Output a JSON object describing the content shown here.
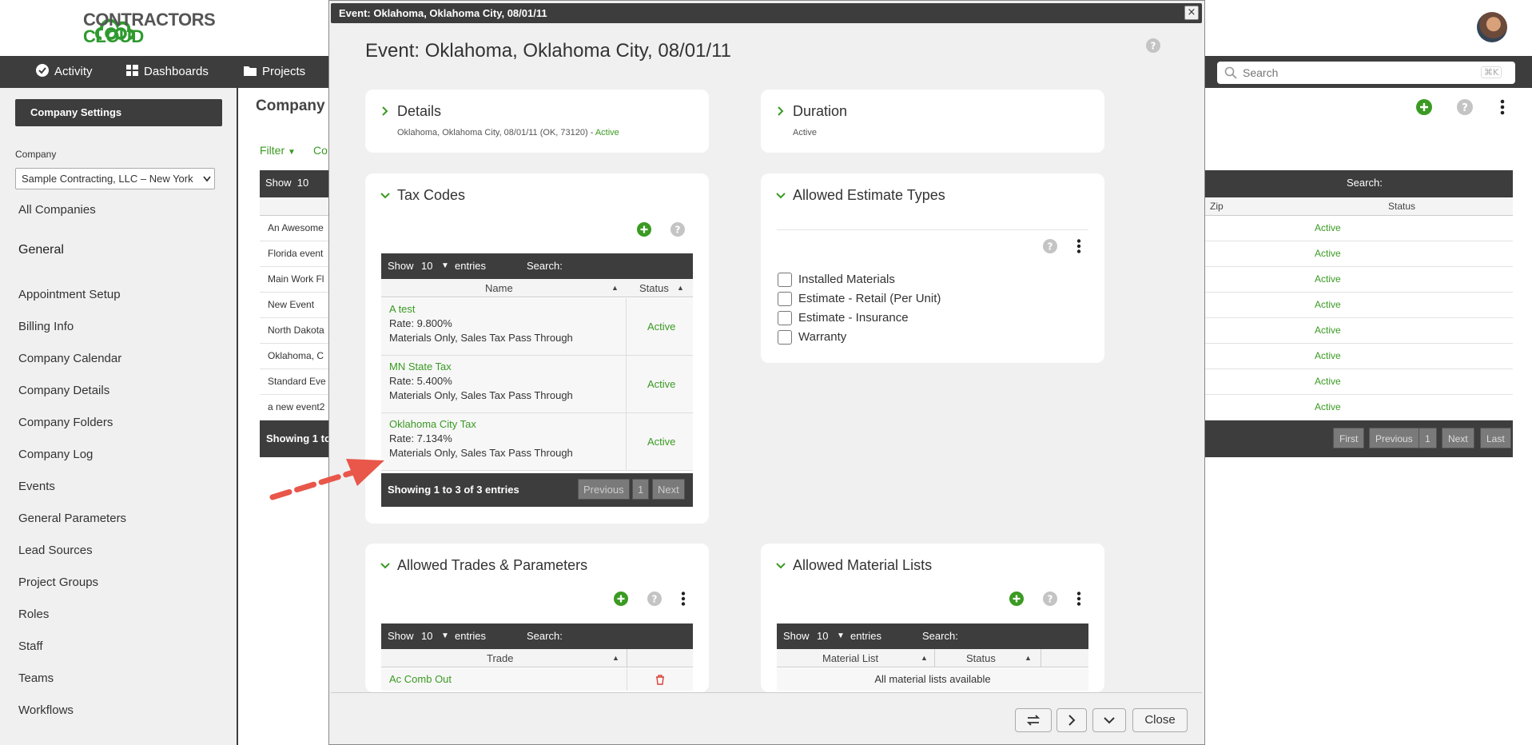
{
  "header": {
    "logo_line1": "CONTRACTORS",
    "logo_line2": "CLOUD",
    "search_placeholder": "Search",
    "search_shortcut": "⌘K"
  },
  "nav": [
    {
      "label": "Activity",
      "icon": "check-circle-icon"
    },
    {
      "label": "Dashboards",
      "icon": "grid-icon"
    },
    {
      "label": "Projects",
      "icon": "folder-icon"
    }
  ],
  "sidebar": {
    "settings_button": "Company Settings",
    "company_label": "Company",
    "company_selected": "Sample Contracting, LLC – New York",
    "all_companies": "All Companies",
    "section_general": "General",
    "items": [
      "Appointment Setup",
      "Billing Info",
      "Company Calendar",
      "Company Details",
      "Company Folders",
      "Company Log",
      "Events",
      "General Parameters",
      "Lead Sources",
      "Project Groups",
      "Roles",
      "Staff",
      "Teams",
      "Workflows"
    ]
  },
  "background": {
    "title": "Company",
    "filter": "Filter",
    "co": "Co",
    "show": "Show",
    "show_count": "10",
    "search_label": "Search:",
    "col_zip": "Zip",
    "col_status": "Status",
    "rows": [
      {
        "name": "An Awesome",
        "status": "Active"
      },
      {
        "name": "Florida event",
        "status": "Active"
      },
      {
        "name": "Main Work Fl",
        "status": "Active"
      },
      {
        "name": "New Event",
        "status": "Active"
      },
      {
        "name": "North Dakota",
        "status": "Active"
      },
      {
        "name": "Oklahoma, C",
        "status": "Active"
      },
      {
        "name": "Standard Eve",
        "status": "Active"
      },
      {
        "name": "a new event2",
        "status": "Active"
      }
    ],
    "showing": "Showing 1 to",
    "pager": [
      "First",
      "Previous",
      "1",
      "Next",
      "Last"
    ]
  },
  "modal": {
    "titlebar": "Event: Oklahoma, Oklahoma City, 08/01/11",
    "close_x": "×",
    "heading": "Event: Oklahoma, Oklahoma City, 08/01/11",
    "details": {
      "title": "Details",
      "subtitle_prefix": "Oklahoma, Oklahoma City, 08/01/11 (OK, 73120) - ",
      "subtitle_status": "Active"
    },
    "duration": {
      "title": "Duration",
      "subtitle": "Active"
    },
    "tax_codes": {
      "title": "Tax Codes",
      "show": "Show",
      "show_count": "10",
      "entries": "entries",
      "search_label": "Search:",
      "col_name": "Name",
      "col_status": "Status",
      "rows": [
        {
          "name": "A test",
          "rate": "Rate: 9.800%",
          "desc": "Materials Only, Sales Tax Pass Through",
          "status": "Active"
        },
        {
          "name": "MN State Tax",
          "rate": "Rate: 5.400%",
          "desc": "Materials Only, Sales Tax Pass Through",
          "status": "Active"
        },
        {
          "name": "Oklahoma City Tax",
          "rate": "Rate: 7.134%",
          "desc": "Materials Only, Sales Tax Pass Through",
          "status": "Active"
        }
      ],
      "showing": "Showing 1 to 3 of 3 entries",
      "pager": [
        "Previous",
        "1",
        "Next"
      ]
    },
    "estimate_types": {
      "title": "Allowed Estimate Types",
      "options": [
        "Installed Materials",
        "Estimate - Retail (Per Unit)",
        "Estimate - Insurance",
        "Warranty"
      ]
    },
    "trades": {
      "title": "Allowed Trades & Parameters",
      "show": "Show",
      "show_count": "10",
      "entries": "entries",
      "search_label": "Search:",
      "col_trade": "Trade",
      "first_row": "Ac Comb Out"
    },
    "material_lists": {
      "title": "Allowed Material Lists",
      "show": "Show",
      "show_count": "10",
      "entries": "entries",
      "search_label": "Search:",
      "col_list": "Material List",
      "col_status": "Status",
      "empty": "All material lists available"
    },
    "footer": {
      "close": "Close"
    }
  },
  "colors": {
    "accent": "#3a9a22",
    "dark": "#3d3d3d",
    "arrow": "#e8574a"
  }
}
